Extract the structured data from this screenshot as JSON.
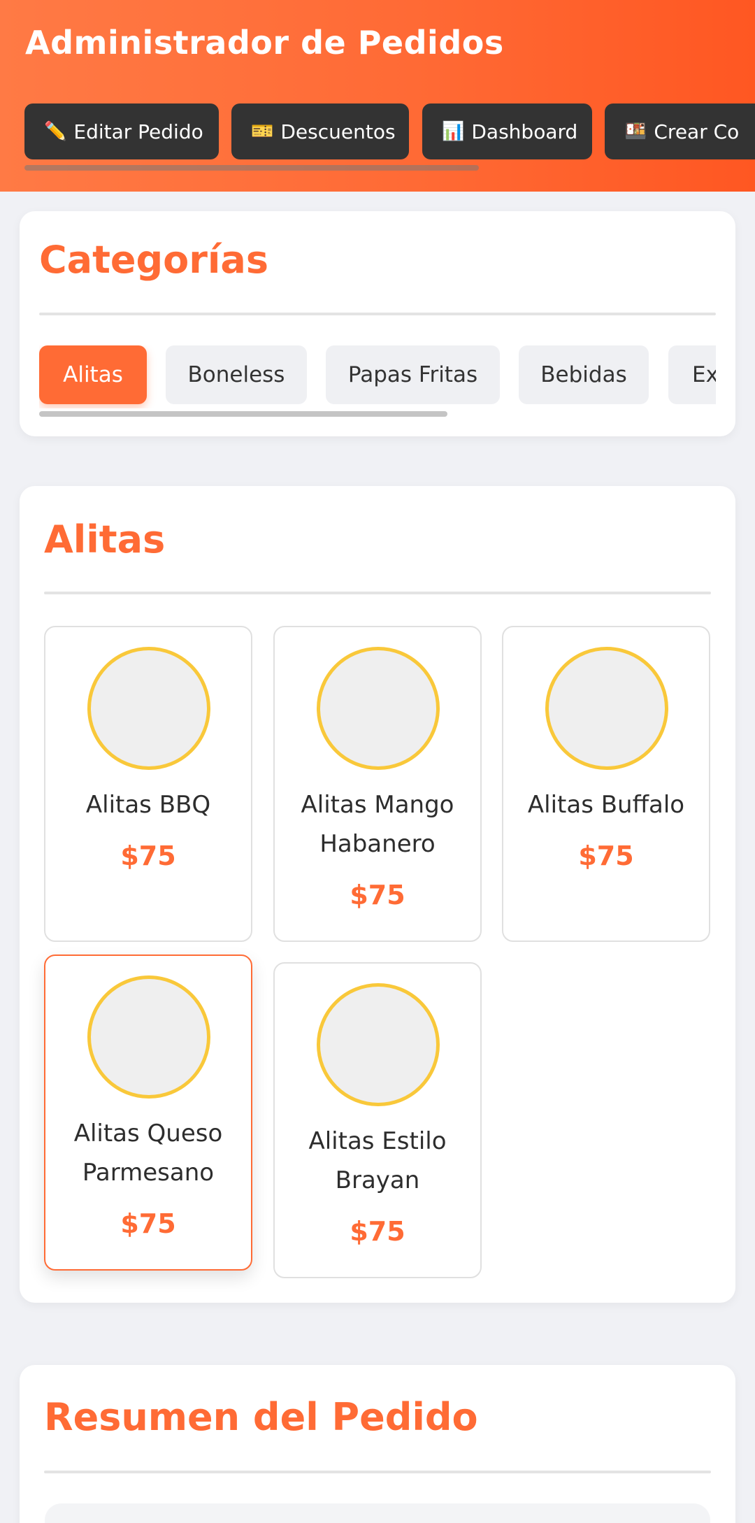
{
  "header": {
    "title": "Administrador de Pedidos",
    "nav": [
      {
        "icon": "✏️",
        "icon_name": "pencil-icon",
        "label": "Editar Pedido"
      },
      {
        "icon": "🎫",
        "icon_name": "ticket-icon",
        "label": "Descuentos"
      },
      {
        "icon": "📊",
        "icon_name": "bar-chart-icon",
        "label": "Dashboard"
      },
      {
        "icon": "🍱",
        "icon_name": "bento-icon",
        "label": "Crear Co"
      }
    ]
  },
  "categories": {
    "title": "Categorías",
    "items": [
      {
        "label": "Alitas",
        "active": true
      },
      {
        "label": "Boneless",
        "active": false
      },
      {
        "label": "Papas Fritas",
        "active": false
      },
      {
        "label": "Bebidas",
        "active": false
      },
      {
        "label": "Ex",
        "active": false
      }
    ]
  },
  "products": {
    "title": "Alitas",
    "items": [
      {
        "name": "Alitas BBQ",
        "price": "$75"
      },
      {
        "name": "Alitas Mango Habanero",
        "price": "$75"
      },
      {
        "name": "Alitas Buffalo",
        "price": "$75"
      },
      {
        "name": "Alitas Queso Parmesano",
        "price": "$75",
        "selected": true
      },
      {
        "name": "Alitas Estilo Brayan",
        "price": "$75"
      }
    ]
  },
  "summary": {
    "title": "Resumen del Pedido"
  },
  "colors": {
    "accent": "#ff6b35",
    "header_gradient_start": "#ff7a45",
    "header_gradient_end": "#ff5722",
    "nav_button": "#333333",
    "image_ring": "#f9c83a"
  }
}
